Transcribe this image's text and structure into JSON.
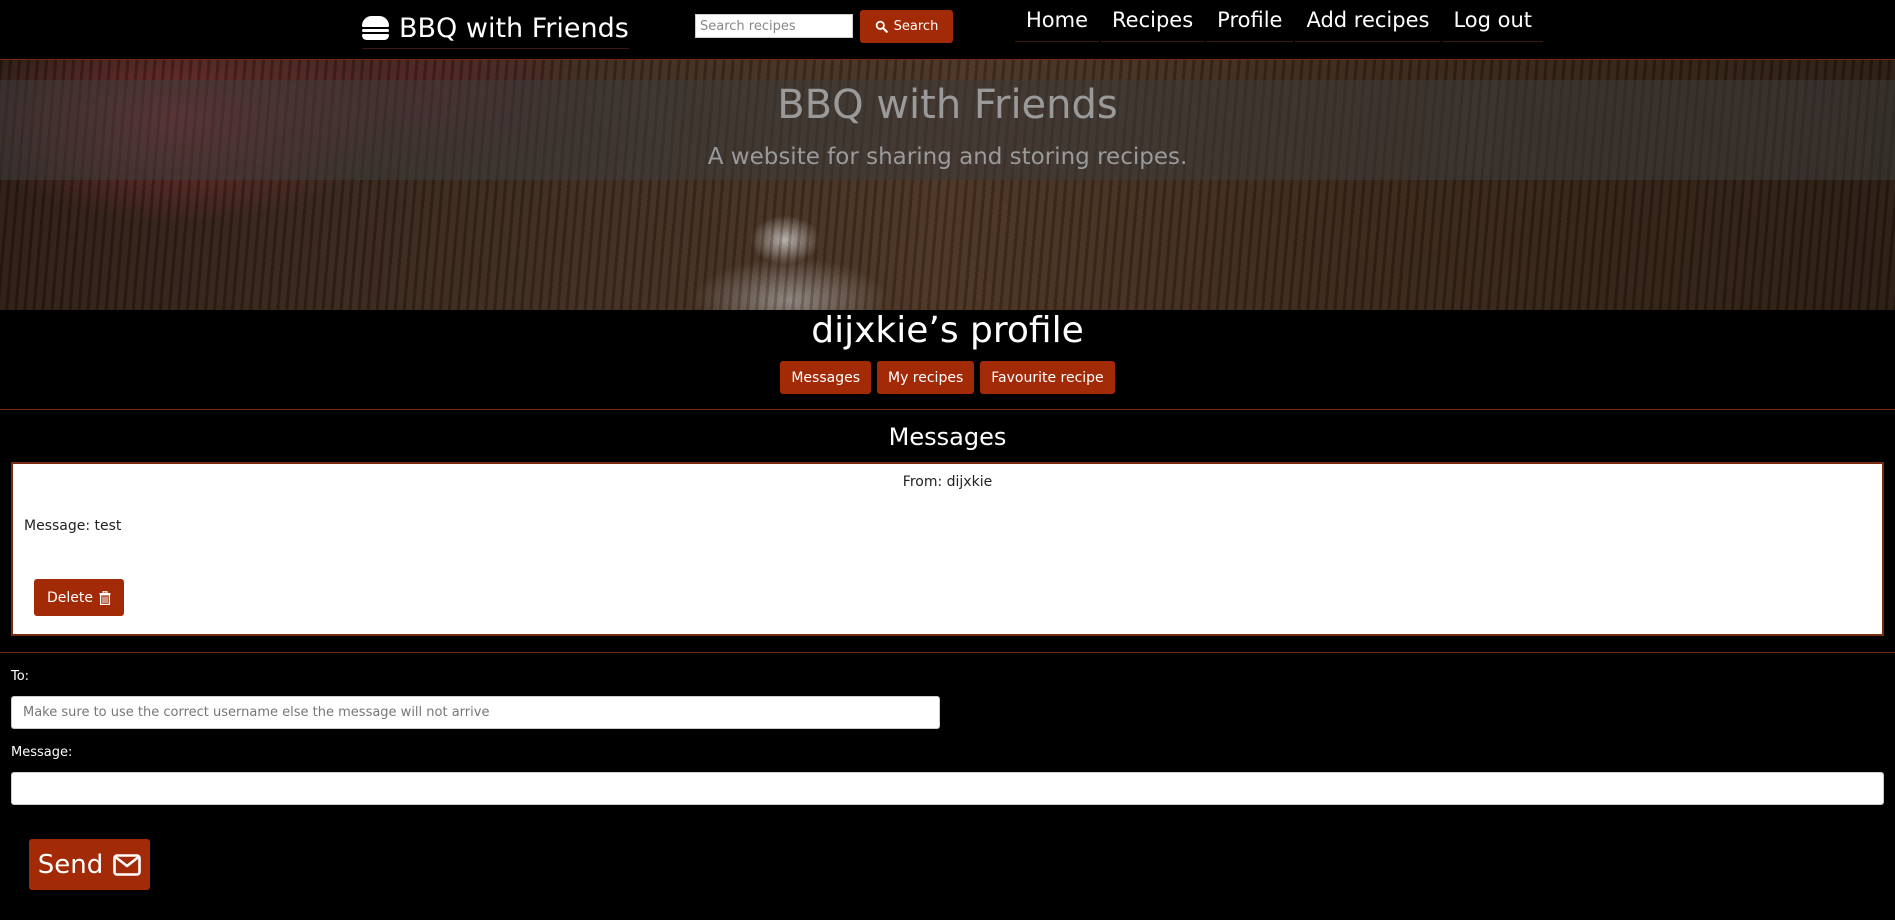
{
  "navbar": {
    "brand": "BBQ with Friends",
    "brand_icon": "hamburger-icon",
    "search": {
      "placeholder": "Search recipes",
      "value": "",
      "button_label": "Search",
      "button_icon": "search-icon"
    },
    "links": [
      "Home",
      "Recipes",
      "Profile",
      "Add recipes",
      "Log out"
    ]
  },
  "hero": {
    "title": "BBQ with Friends",
    "subtitle": "A website for sharing and storing recipes."
  },
  "profile": {
    "title": "dijxkie’s profile",
    "tabs": [
      "Messages",
      "My recipes",
      "Favourite recipe"
    ]
  },
  "messages": {
    "heading": "Messages",
    "items": [
      {
        "from": "From: dijxkie",
        "body": "Message: test",
        "delete_label": "Delete",
        "delete_icon": "trash-icon"
      }
    ]
  },
  "compose": {
    "to_label": "To:",
    "to_placeholder": "Make sure to use the correct username else the message will not arrive",
    "to_value": "",
    "message_label": "Message:",
    "message_value": "",
    "send_label": "Send",
    "send_icon": "envelope-icon"
  },
  "colors": {
    "accent": "#a22a06",
    "border": "#7a2a10",
    "background": "#000000"
  }
}
